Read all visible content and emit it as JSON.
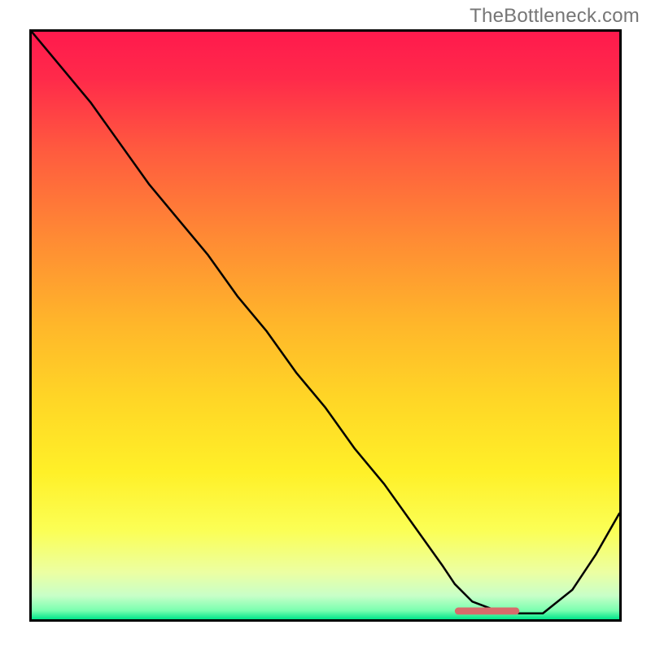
{
  "watermark": "TheBottleneck.com",
  "chart_data": {
    "type": "line",
    "title": "",
    "xlabel": "",
    "ylabel": "",
    "x_range": [
      0,
      1
    ],
    "y_range": [
      0,
      1
    ],
    "series": [
      {
        "name": "curve",
        "x": [
          0.0,
          0.05,
          0.1,
          0.15,
          0.2,
          0.25,
          0.3,
          0.35,
          0.4,
          0.45,
          0.5,
          0.55,
          0.6,
          0.65,
          0.7,
          0.72,
          0.75,
          0.79,
          0.83,
          0.83,
          0.87,
          0.92,
          0.96,
          1.0
        ],
        "y": [
          1.0,
          0.94,
          0.88,
          0.81,
          0.74,
          0.68,
          0.62,
          0.55,
          0.49,
          0.42,
          0.36,
          0.29,
          0.23,
          0.16,
          0.09,
          0.06,
          0.03,
          0.015,
          0.01,
          0.01,
          0.01,
          0.05,
          0.11,
          0.18
        ]
      }
    ],
    "marker_band": {
      "x_start": 0.72,
      "x_end": 0.83,
      "y": 0.014,
      "color": "#d86b6b"
    },
    "gradient_stops": [
      {
        "offset": 0.0,
        "color": "#ff1a4d"
      },
      {
        "offset": 0.08,
        "color": "#ff2a4a"
      },
      {
        "offset": 0.2,
        "color": "#ff5a3f"
      },
      {
        "offset": 0.35,
        "color": "#ff8a34"
      },
      {
        "offset": 0.5,
        "color": "#ffb72a"
      },
      {
        "offset": 0.63,
        "color": "#ffd726"
      },
      {
        "offset": 0.75,
        "color": "#fff028"
      },
      {
        "offset": 0.85,
        "color": "#fbff56"
      },
      {
        "offset": 0.92,
        "color": "#ecffa2"
      },
      {
        "offset": 0.96,
        "color": "#c8ffc8"
      },
      {
        "offset": 0.985,
        "color": "#7affb0"
      },
      {
        "offset": 1.0,
        "color": "#00e58a"
      }
    ]
  }
}
